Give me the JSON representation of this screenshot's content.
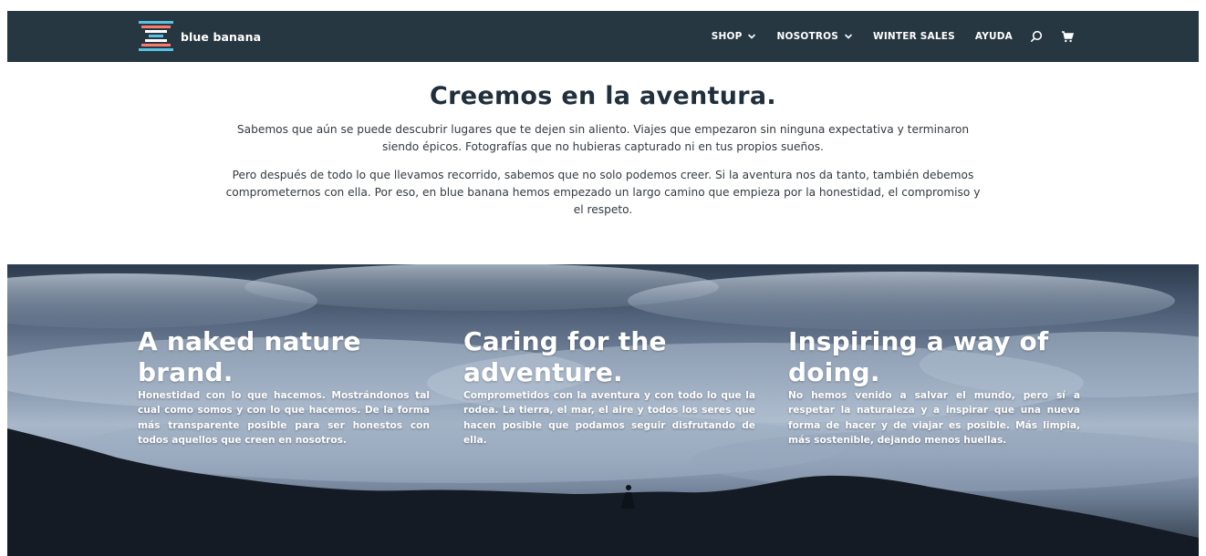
{
  "brand": {
    "name": "blue banana",
    "logo_icon": "x-stripes-logo",
    "colors": [
      "#ff7a6b",
      "#ffffff",
      "#58c2e3"
    ]
  },
  "nav": {
    "items": [
      {
        "label": "SHOP",
        "has_dropdown": true
      },
      {
        "label": "NOSOTROS",
        "has_dropdown": true
      },
      {
        "label": "WINTER SALES",
        "has_dropdown": false
      },
      {
        "label": "AYUDA",
        "has_dropdown": false
      }
    ],
    "search_icon": "search-icon",
    "cart_icon": "cart-icon",
    "background": "#263741"
  },
  "intro": {
    "title": "Creemos en la aventura.",
    "paragraph1": "Sabemos que aún se puede descubrir lugares que te dejen sin aliento. Viajes que empezaron sin ninguna expectativa y terminaron siendo épicos. Fotografías que no hubieras capturado ni en tus propios sueños.",
    "paragraph2": "Pero después de todo lo que llevamos recorrido, sabemos que no solo podemos creer. Si la aventura nos da tanto, también debemos comprometernos con ella. Por eso, en blue banana hemos empezado un largo camino que empieza por la honestidad, el compromiso y el respeto."
  },
  "banner": {
    "columns": [
      {
        "title": "A naked nature brand.",
        "text": "Honestidad con lo que hacemos. Mostrándonos tal cual como somos y con lo que hacemos. De la forma más transparente posible para ser honestos con todos aquellos que creen en nosotros."
      },
      {
        "title": "Caring for the adventure.",
        "text": "Comprometidos con la aventura y con todo lo que la rodea. La tierra, el mar, el aire y todos los seres que hacen posible que podamos seguir disfrutando de ella."
      },
      {
        "title": "Inspiring a way of doing.",
        "text": "No hemos venido a salvar el mundo, pero sí a respetar la naturaleza y a inspirar que una nueva forma de hacer y de viajar es posible. Más limpia, más sostenible, dejando menos huellas."
      }
    ]
  }
}
